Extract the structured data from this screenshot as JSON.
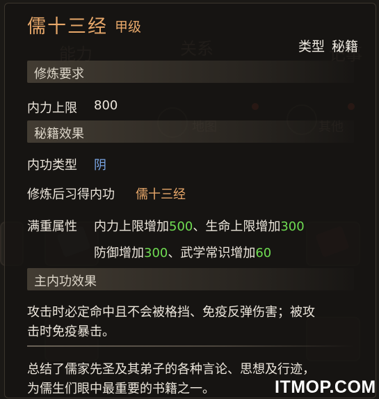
{
  "background": {
    "tab_left": "能力",
    "tab_middle": "关系",
    "tab_right": "记事",
    "icon_map_label": "地图",
    "icon_other_label": "其他"
  },
  "header": {
    "title": "儒十三经",
    "grade": "甲级",
    "type_label": "类型",
    "type_value": "秘籍"
  },
  "requirements": {
    "heading": "修炼要求",
    "label": "内力上限",
    "value": "800"
  },
  "effects": {
    "heading": "秘籍效果",
    "type_label": "内功类型",
    "type_value": "阴",
    "learn_label": "修炼后习得内功",
    "learn_value": "儒十三经",
    "full_label": "满重属性",
    "line1": {
      "a_text": "内力上限增加",
      "a_value": "500",
      "sep": "、",
      "b_text": "生命上限增加",
      "b_value": "300"
    },
    "line2": {
      "a_text": "防御增加",
      "a_value": "300",
      "sep": "、",
      "b_text": "武学常识增加",
      "b_value": "60"
    }
  },
  "main_effect": {
    "heading": "主内功效果",
    "line1": "攻击时必定命中且不会被格挡、免疫反弹伤害；被攻",
    "line2": "击时免疫暴击。"
  },
  "description": {
    "line1": "总结了儒家先圣及其弟子的各种言论、思想及行迹，",
    "line2": "为儒生们眼中最重要的书籍之一。"
  },
  "watermark": "ITMOP.COM",
  "colors": {
    "title": "#e8a86a",
    "bonus": "#6fdc52",
    "yin": "#7aa6e6"
  }
}
